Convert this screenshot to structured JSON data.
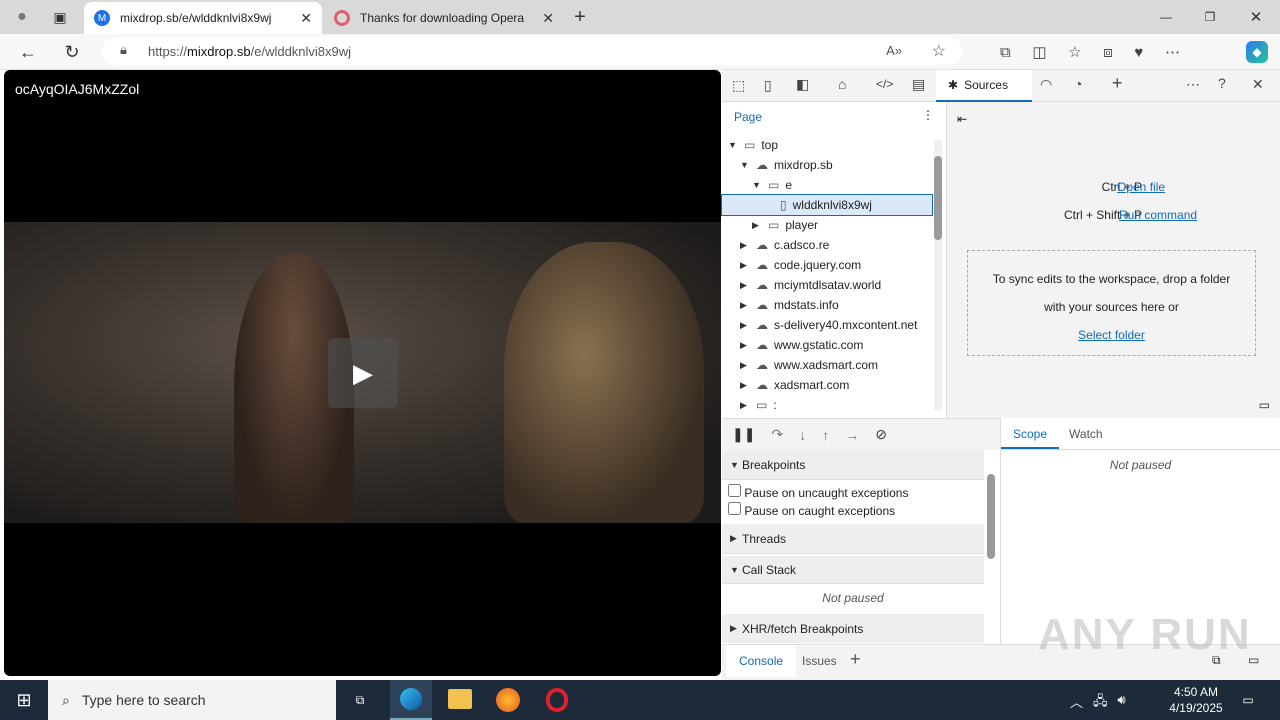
{
  "browser": {
    "tabs": [
      {
        "title": "mixdrop.sb/e/wlddknlvi8x9wj",
        "active": true
      },
      {
        "title": "Thanks for downloading Opera",
        "active": false
      }
    ],
    "url_prefix": "https://",
    "url_host": "mixdrop.sb",
    "url_path": "/e/wlddknlvi8x9wj"
  },
  "video": {
    "title": "ocAyqOIAJ6MxZZol"
  },
  "devtools": {
    "active_tab": "Sources",
    "navigator_tab": "Page",
    "tree": [
      {
        "label": "top",
        "depth": 0,
        "type": "frame",
        "open": true
      },
      {
        "label": "mixdrop.sb",
        "depth": 1,
        "type": "cloud",
        "open": true
      },
      {
        "label": "e",
        "depth": 2,
        "type": "folder",
        "open": true
      },
      {
        "label": "wlddknlvi8x9wj",
        "depth": 3,
        "type": "file",
        "selected": true
      },
      {
        "label": "player",
        "depth": 2,
        "type": "folder",
        "open": false
      },
      {
        "label": "c.adsco.re",
        "depth": 1,
        "type": "cloud"
      },
      {
        "label": "code.jquery.com",
        "depth": 1,
        "type": "cloud"
      },
      {
        "label": "mciymtdlsatav.world",
        "depth": 1,
        "type": "cloud"
      },
      {
        "label": "mdstats.info",
        "depth": 1,
        "type": "cloud"
      },
      {
        "label": "s-delivery40.mxcontent.net",
        "depth": 1,
        "type": "cloud"
      },
      {
        "label": "www.gstatic.com",
        "depth": 1,
        "type": "cloud"
      },
      {
        "label": "www.xadsmart.com",
        "depth": 1,
        "type": "cloud"
      },
      {
        "label": "xadsmart.com",
        "depth": 1,
        "type": "cloud"
      },
      {
        "label": ":",
        "depth": 1,
        "type": "frame"
      }
    ],
    "shortcut1_keys": "Ctrl + P",
    "shortcut1_action": "Open file",
    "shortcut2_keys": "Ctrl + Shift + P",
    "shortcut2_action": "Run command",
    "drop_text": "To sync edits to the workspace, drop a folder with your sources here or",
    "select_folder": "Select folder",
    "breakpoints": "Breakpoints",
    "pause_uncaught": "Pause on uncaught exceptions",
    "pause_caught": "Pause on caught exceptions",
    "threads": "Threads",
    "call_stack": "Call Stack",
    "not_paused": "Not paused",
    "xhr": "XHR/fetch Breakpoints",
    "scope": "Scope",
    "watch": "Watch",
    "scope_not_paused": "Not paused",
    "console": "Console",
    "issues": "Issues"
  },
  "taskbar": {
    "search_placeholder": "Type here to search",
    "time": "4:50 AM",
    "date": "4/19/2025"
  },
  "watermark": "ANY RUN"
}
